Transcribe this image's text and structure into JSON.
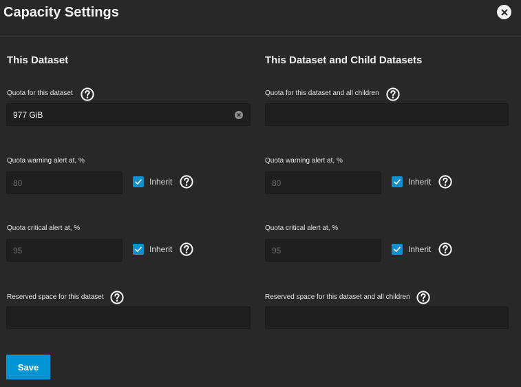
{
  "dialog": {
    "title": "Capacity Settings"
  },
  "left": {
    "section_title": "This Dataset",
    "quota": {
      "label": "Quota for this dataset",
      "value": "977 GiB"
    },
    "warning": {
      "label": "Quota warning alert at, %",
      "value": "80",
      "inherit_label": "Inherit",
      "inherit_checked": true
    },
    "critical": {
      "label": "Quota critical alert at, %",
      "value": "95",
      "inherit_label": "Inherit",
      "inherit_checked": true
    },
    "reserved": {
      "label": "Reserved space for this dataset",
      "value": ""
    }
  },
  "right": {
    "section_title": "This Dataset and Child Datasets",
    "quota": {
      "label": "Quota for this dataset and all children",
      "value": ""
    },
    "warning": {
      "label": "Quota warning alert at, %",
      "value": "80",
      "inherit_label": "Inherit",
      "inherit_checked": true
    },
    "critical": {
      "label": "Quota critical alert at, %",
      "value": "95",
      "inherit_label": "Inherit",
      "inherit_checked": true
    },
    "reserved": {
      "label": "Reserved space for this dataset and all children",
      "value": ""
    }
  },
  "actions": {
    "save_label": "Save"
  },
  "icons": {
    "help": "help-circle-icon",
    "close": "close-circle-icon",
    "check": "check-icon",
    "clear": "clear-input-icon"
  },
  "colors": {
    "accent": "#0095d5",
    "checkbox": "#0e8fce",
    "background": "#282828",
    "input": "#1f1f1f"
  }
}
